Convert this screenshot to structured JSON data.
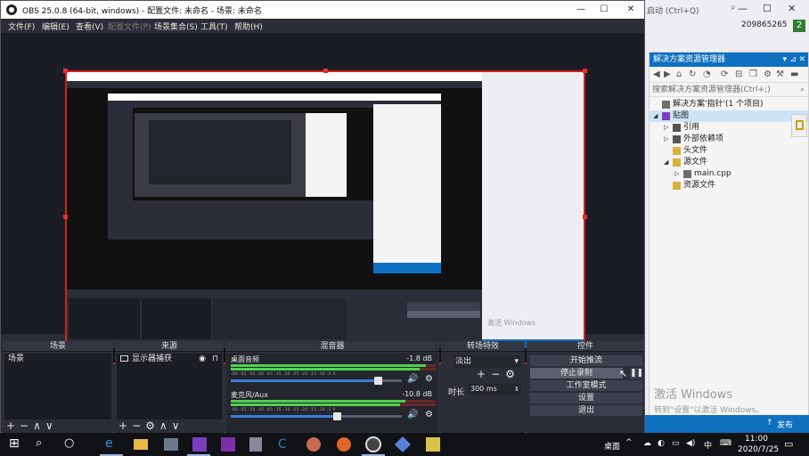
{
  "obs": {
    "title": "OBS 25.0.8 (64-bit, windows) - 配置文件: 未命名 - 场景: 未命名",
    "menu": [
      {
        "label": "文件(F)",
        "enabled": true
      },
      {
        "label": "编辑(E)",
        "enabled": true
      },
      {
        "label": "查看(V)",
        "enabled": true
      },
      {
        "label": "配置文件(P)",
        "enabled": false
      },
      {
        "label": "场景集合(S)",
        "enabled": true
      },
      {
        "label": "工具(T)",
        "enabled": true
      },
      {
        "label": "帮助(H)",
        "enabled": true
      }
    ],
    "docks": {
      "scenes": {
        "title": "场景",
        "items": [
          "场景"
        ]
      },
      "sources": {
        "title": "来源",
        "items": [
          "显示器捕获"
        ]
      },
      "mixer": {
        "title": "混音器",
        "channels": [
          {
            "name": "桌面音频",
            "db": "-1.8 dB",
            "level": 0.95,
            "volume": 0.86
          },
          {
            "name": "麦克风/Aux",
            "db": "-10.8 dB",
            "level": 0.85,
            "volume": 0.62
          }
        ],
        "ticks": "-60 -55 -50 -45 -40 -35 -30 -25 -20 -15 -10 -5 0"
      },
      "transitions": {
        "title": "转场特效",
        "type": "淡出",
        "duration_label": "时长",
        "duration": "300 ms"
      },
      "controls": {
        "title": "控件",
        "buttons": [
          "开始推流",
          "停止录制",
          "工作室模式",
          "设置",
          "退出"
        ]
      }
    }
  },
  "vs": {
    "quick_launch": "启动 (Ctrl+Q)",
    "user": "209865265",
    "badge": "2",
    "solution_explorer": {
      "title": "解决方案资源管理器",
      "search_placeholder": "搜索解决方案资源管理器(Ctrl+;)",
      "tree": [
        {
          "label": "解决方案'指针'(1 个项目)",
          "depth": 0,
          "arrow": ""
        },
        {
          "label": "贴图",
          "depth": 0,
          "arrow": "◢",
          "selected": true
        },
        {
          "label": "引用",
          "depth": 1,
          "arrow": "▷"
        },
        {
          "label": "外部依赖项",
          "depth": 1,
          "arrow": "▷"
        },
        {
          "label": "头文件",
          "depth": 1,
          "arrow": ""
        },
        {
          "label": "源文件",
          "depth": 1,
          "arrow": "◢"
        },
        {
          "label": "main.cpp",
          "depth": 2,
          "arrow": "▷"
        },
        {
          "label": "资源文件",
          "depth": 1,
          "arrow": ""
        }
      ]
    },
    "status_publish": "发布"
  },
  "watermark": {
    "line1": "激活 Windows",
    "line2": "转到\"设置\"以激活 Windows。"
  },
  "taskbar": {
    "desktop_label": "桌面",
    "ime": "中",
    "time": "11:00",
    "date": "2020/7/25"
  },
  "colors": {
    "obs_bg": "#2b2e38",
    "preview_border": "#d31f1f",
    "vs_accent": "#0e70c0"
  }
}
